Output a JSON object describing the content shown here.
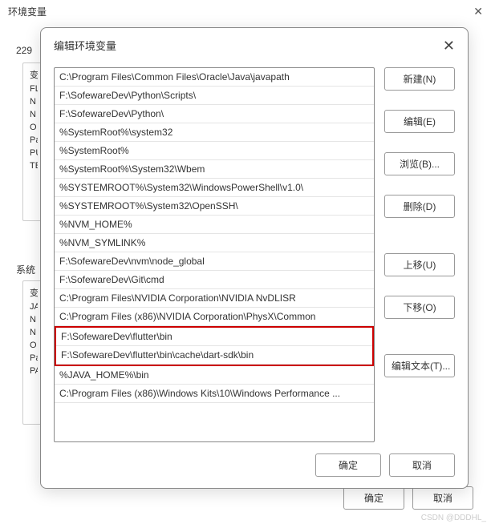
{
  "outer": {
    "title": "环境变量",
    "sections": {
      "user_label_prefix": "229",
      "user_vars_label": "变",
      "user_items": [
        "FL",
        "N",
        "N",
        "O",
        "Pa",
        "PU",
        "TE"
      ],
      "system_label": "系统",
      "system_vars_label": "变",
      "system_items": [
        "JA",
        "N",
        "N",
        "O",
        "Pa",
        "PA"
      ]
    },
    "footer": {
      "ok": "确定",
      "cancel": "取消"
    }
  },
  "modal": {
    "title": "编辑环境变量",
    "paths": [
      "C:\\Program Files\\Common Files\\Oracle\\Java\\javapath",
      "F:\\SofewareDev\\Python\\Scripts\\",
      "F:\\SofewareDev\\Python\\",
      "%SystemRoot%\\system32",
      "%SystemRoot%",
      "%SystemRoot%\\System32\\Wbem",
      "%SYSTEMROOT%\\System32\\WindowsPowerShell\\v1.0\\",
      "%SYSTEMROOT%\\System32\\OpenSSH\\",
      "%NVM_HOME%",
      "%NVM_SYMLINK%",
      "F:\\SofewareDev\\nvm\\node_global",
      "F:\\SofewareDev\\Git\\cmd",
      "C:\\Program Files\\NVIDIA Corporation\\NVIDIA NvDLISR",
      "C:\\Program Files (x86)\\NVIDIA Corporation\\PhysX\\Common",
      "F:\\SofewareDev\\flutter\\bin",
      "F:\\SofewareDev\\flutter\\bin\\cache\\dart-sdk\\bin",
      "%JAVA_HOME%\\bin",
      "C:\\Program Files (x86)\\Windows Kits\\10\\Windows Performance ..."
    ],
    "highlighted_indices": [
      14,
      15
    ],
    "buttons": {
      "new": "新建(N)",
      "edit": "编辑(E)",
      "browse": "浏览(B)...",
      "delete": "删除(D)",
      "move_up": "上移(U)",
      "move_down": "下移(O)",
      "edit_text": "编辑文本(T)..."
    },
    "footer": {
      "ok": "确定",
      "cancel": "取消"
    }
  },
  "watermark": "CSDN @DDDHL_"
}
